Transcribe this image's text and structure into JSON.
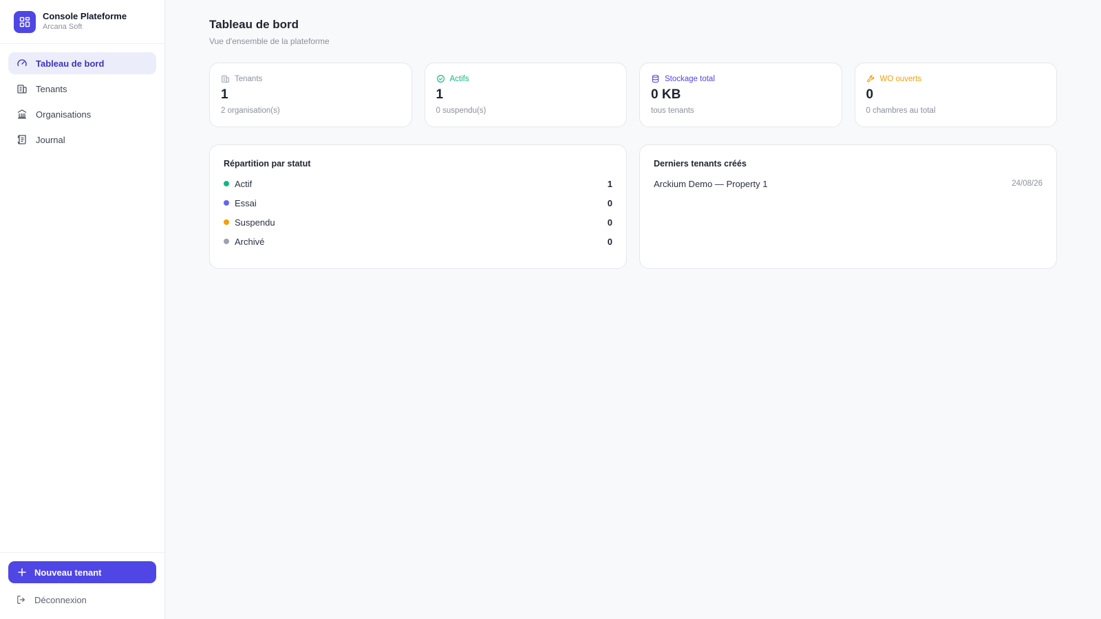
{
  "brand": {
    "title": "Console Plateforme",
    "subtitle": "Arcana Soft",
    "logo_icon": "grid-icon",
    "accent": "#4f46e5"
  },
  "nav": [
    {
      "label": "Tableau de bord",
      "icon": "gauge-icon",
      "active": true
    },
    {
      "label": "Tenants",
      "icon": "building-icon",
      "active": false
    },
    {
      "label": "Organisations",
      "icon": "bank-icon",
      "active": false
    },
    {
      "label": "Journal",
      "icon": "scroll-icon",
      "active": false
    }
  ],
  "actions": {
    "new_tenant": "Nouveau tenant",
    "logout": "Déconnexion"
  },
  "page": {
    "title": "Tableau de bord",
    "subtitle": "Vue d'ensemble de la plateforme"
  },
  "stats": [
    {
      "label": "Tenants",
      "value": "1",
      "note": "2 organisation(s)",
      "icon": "building-icon",
      "color": "#8a909c"
    },
    {
      "label": "Actifs",
      "value": "1",
      "note": "0 suspendu(s)",
      "icon": "check-circle-icon",
      "color": "#10b981"
    },
    {
      "label": "Stockage total",
      "value": "0 KB",
      "note": "tous tenants",
      "icon": "database-icon",
      "color": "#4f46e5"
    },
    {
      "label": "WO ouverts",
      "value": "0",
      "note": "0 chambres au total",
      "icon": "wrench-icon",
      "color": "#f59e0b"
    }
  ],
  "status_panel": {
    "title": "Répartition par statut",
    "items": [
      {
        "label": "Actif",
        "count": "1",
        "color": "#10b981"
      },
      {
        "label": "Essai",
        "count": "0",
        "color": "#6366f1"
      },
      {
        "label": "Suspendu",
        "count": "0",
        "color": "#f59e0b"
      },
      {
        "label": "Archivé",
        "count": "0",
        "color": "#9ca3af"
      }
    ]
  },
  "recent_panel": {
    "title": "Derniers tenants créés",
    "items": [
      {
        "name": "Arckium Demo — Property 1",
        "date": "24/08/26"
      }
    ]
  }
}
